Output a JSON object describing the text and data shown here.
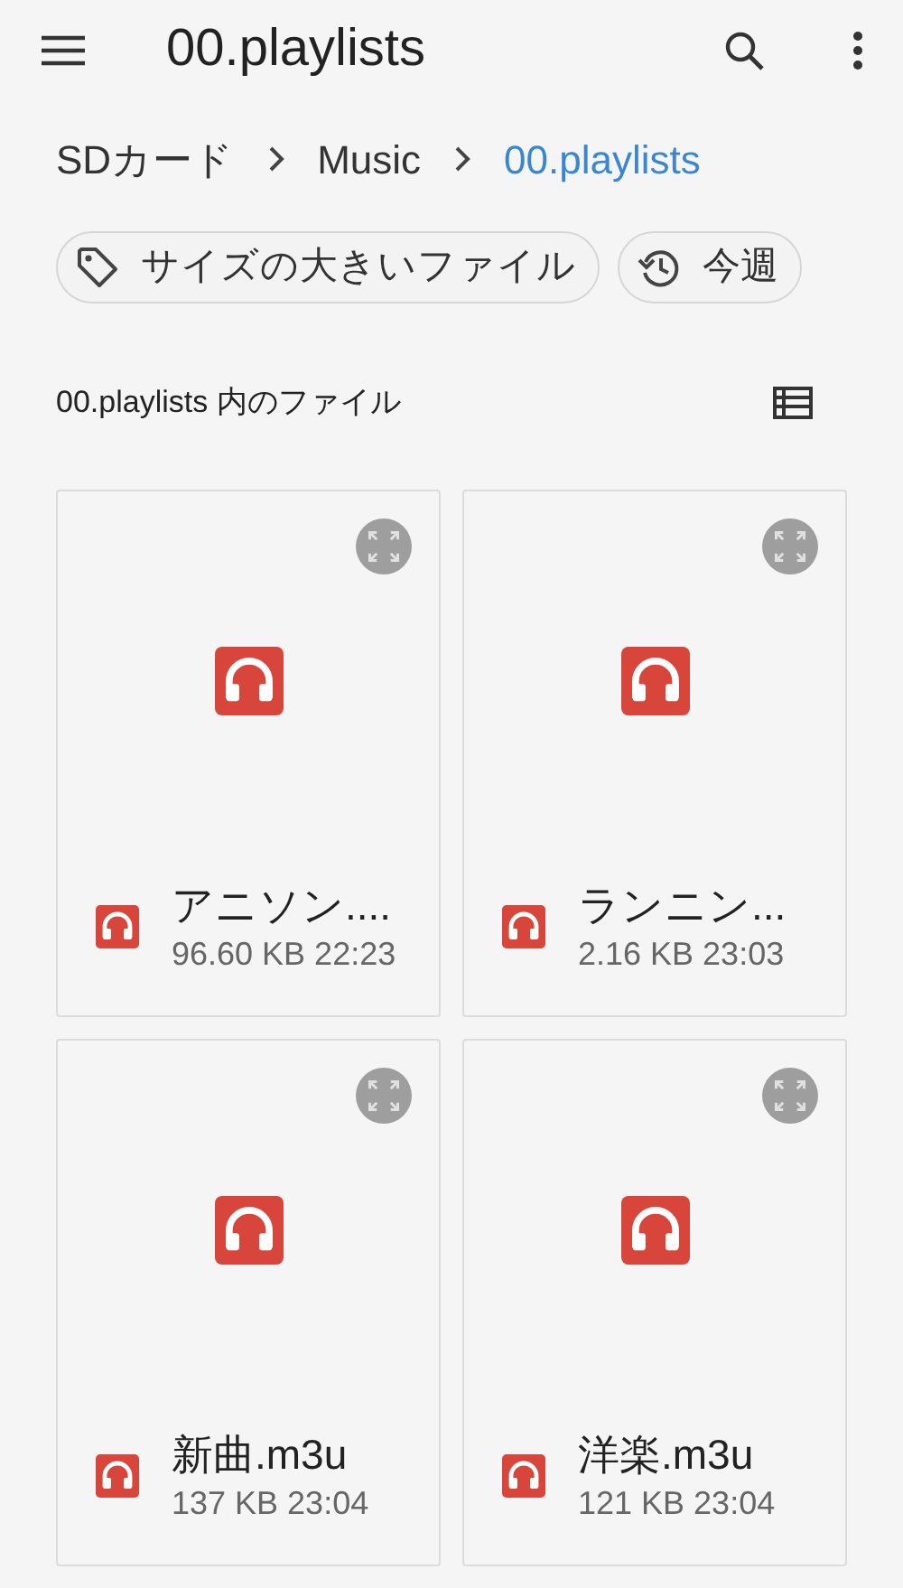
{
  "app_bar": {
    "title": "00.playlists"
  },
  "breadcrumbs": [
    {
      "label": "SDカード",
      "selected": false
    },
    {
      "label": "Music",
      "selected": false
    },
    {
      "label": "00.playlists",
      "selected": true
    }
  ],
  "chips": [
    {
      "kind": "tag",
      "label": "サイズの大きいファイル"
    },
    {
      "kind": "history",
      "label": "今週"
    }
  ],
  "section": {
    "title": "00.playlists 内のファイル"
  },
  "files": [
    {
      "name": "アニソン....",
      "details": "96.60 KB 22:23"
    },
    {
      "name": "ランニン...",
      "details": "2.16 KB 23:03"
    },
    {
      "name": "新曲.m3u",
      "details": "137 KB 23:04"
    },
    {
      "name": "洋楽.m3u",
      "details": "121 KB 23:04"
    }
  ]
}
